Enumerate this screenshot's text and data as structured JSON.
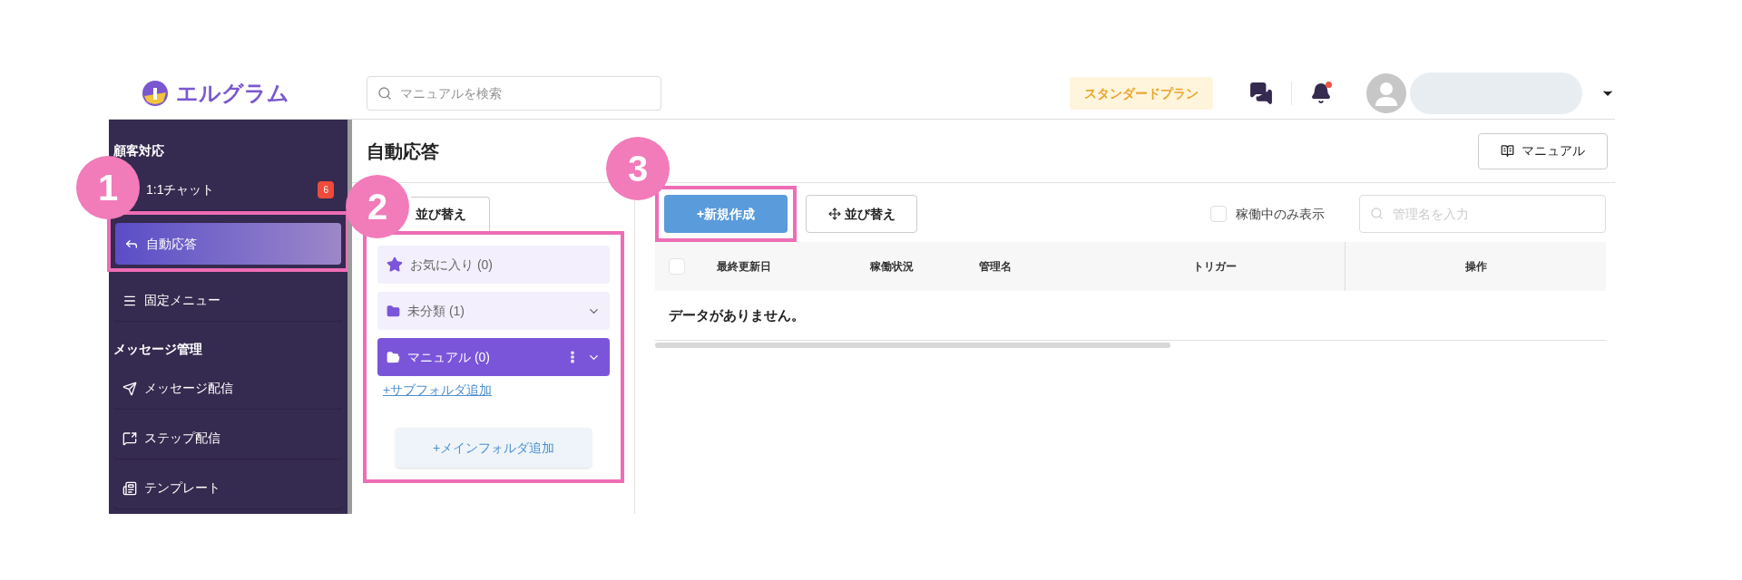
{
  "header": {
    "logo": "エルグラム",
    "search": {
      "placeholder": "マニュアルを検索"
    },
    "plan": "スタンダードプラン",
    "notification_dot": true
  },
  "sidebar": {
    "sections": [
      {
        "title": "顧客対応",
        "items": [
          {
            "label": "1:1チャット",
            "badge": "6",
            "selected": false
          },
          {
            "label": "自動応答",
            "selected": true
          },
          {
            "label": "固定メニュー",
            "selected": false
          }
        ]
      },
      {
        "title": "メッセージ管理",
        "items": [
          {
            "label": "メッセージ配信",
            "selected": false
          },
          {
            "label": "ステップ配信",
            "selected": false
          },
          {
            "label": "テンプレート",
            "selected": false
          }
        ]
      }
    ]
  },
  "page": {
    "title": "自動応答",
    "manual_button": "マニュアル"
  },
  "folders": {
    "sort_button": "並び替え",
    "items": [
      {
        "kind": "favorite",
        "label": "お気に入り (0)",
        "selected": false
      },
      {
        "kind": "folder",
        "label": "未分類 (1)",
        "selected": false
      },
      {
        "kind": "folder",
        "label": "マニュアル (0)",
        "selected": true
      }
    ],
    "add_subfolder": "+サブフォルダ追加",
    "add_main_folder": "+メインフォルダ追加"
  },
  "toolbar": {
    "new_button": "+新規作成",
    "sort_button": "並び替え",
    "filter": {
      "label": "稼働中のみ表示",
      "checked": false
    },
    "search": {
      "placeholder": "管理名を入力"
    }
  },
  "table": {
    "select_all": {
      "checked": false
    },
    "columns": [
      "最終更新日",
      "稼働状況",
      "管理名",
      "トリガー",
      "操作"
    ],
    "empty_text": "データがありません。"
  },
  "annotations": [
    {
      "label": "1"
    },
    {
      "label": "2"
    },
    {
      "label": "3"
    }
  ]
}
